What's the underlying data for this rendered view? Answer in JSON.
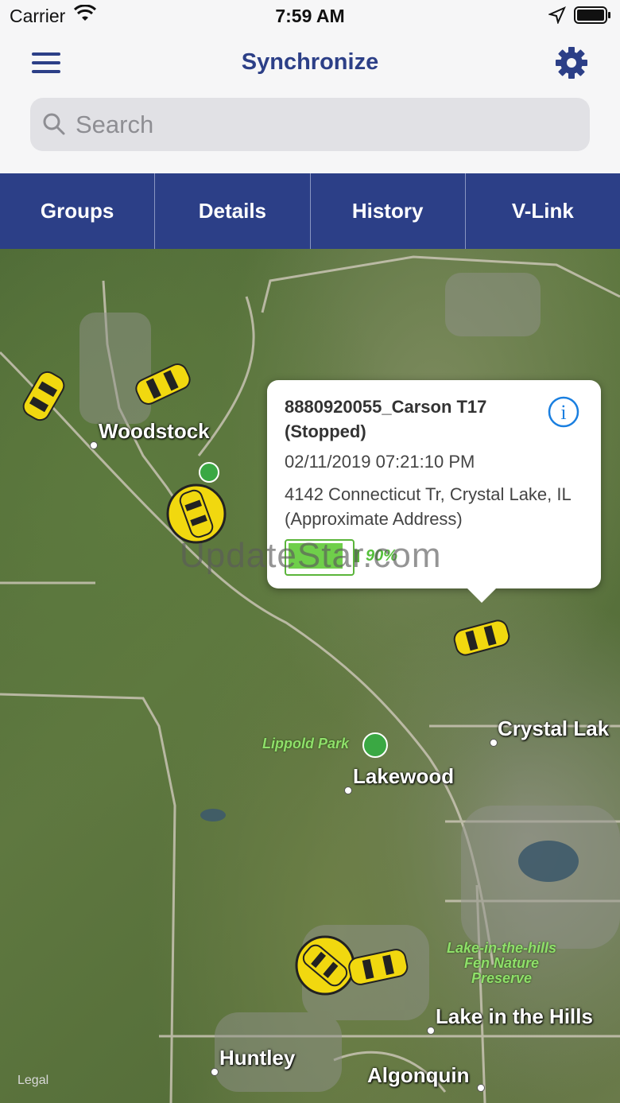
{
  "status_bar": {
    "carrier": "Carrier",
    "time": "7:59 AM"
  },
  "header": {
    "title": "Synchronize",
    "accent_color": "#2c3f87"
  },
  "search": {
    "placeholder": "Search"
  },
  "tabs": [
    {
      "label": "Groups"
    },
    {
      "label": "Details"
    },
    {
      "label": "History"
    },
    {
      "label": "V-Link"
    }
  ],
  "map": {
    "places": [
      {
        "name": "Woodstock"
      },
      {
        "name": "Crystal Lak"
      },
      {
        "name": "Lakewood"
      },
      {
        "name": "Lake in the Hills"
      },
      {
        "name": "Huntley"
      },
      {
        "name": "Algonquin"
      }
    ],
    "parks": [
      {
        "name": "Lippold Park"
      },
      {
        "name": "Lake-in-the-hills Fen Nature Preserve"
      }
    ],
    "legal": "Legal"
  },
  "callout": {
    "vehicle": "8880920055_Carson T17 (Stopped)",
    "timestamp": "02/11/2019 07:21:10 PM",
    "address": "4142 Connecticut Tr, Crystal Lake, IL (Approximate Address)",
    "battery_percent": "90%",
    "battery_level": 0.9,
    "watermark": "UpdateStar.com"
  }
}
